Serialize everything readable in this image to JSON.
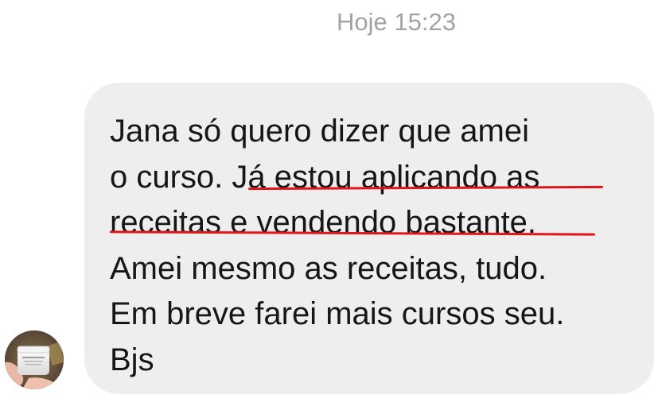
{
  "header": {
    "timestamp": "Hoje 15:23"
  },
  "message": {
    "lines": [
      "Jana só quero dizer que amei",
      "o curso. Já estou aplicando as",
      "receitas e vendendo bastante.",
      "Amei mesmo as receitas, tudo.",
      "Em breve farei mais cursos seu.",
      "Bjs"
    ]
  },
  "colors": {
    "bubble": "#eeeeee",
    "text": "#161616",
    "timestamp": "#a3a3a3",
    "highlight_underline": "#e0161c"
  },
  "avatar": {
    "icon": "sender-avatar-photo"
  }
}
